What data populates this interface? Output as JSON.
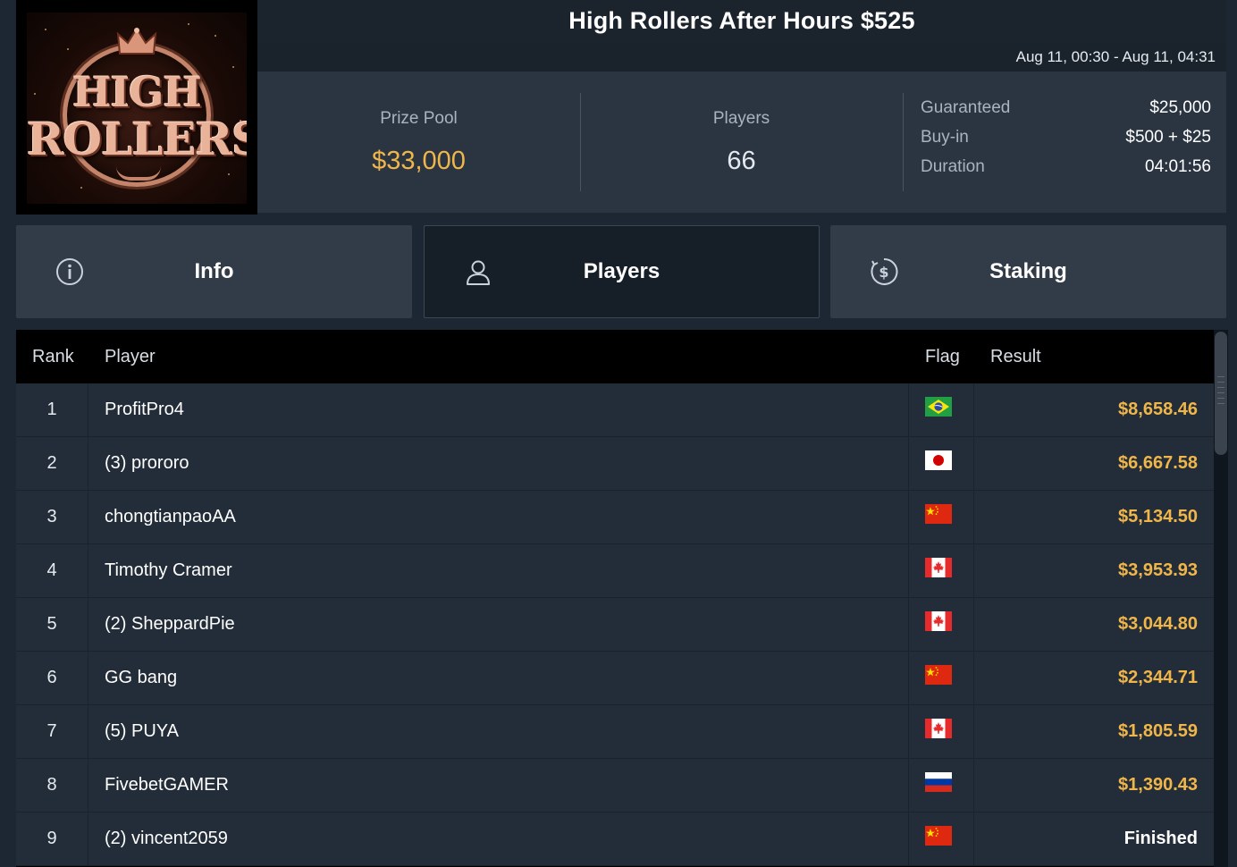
{
  "logo": {
    "line1": "HIGH",
    "line2": "ROLLERS"
  },
  "title": "High Rollers After Hours $525",
  "date_range": "Aug 11, 00:30 - Aug 11, 04:31",
  "stats": {
    "prize_pool_label": "Prize Pool",
    "prize_pool_value": "$33,000",
    "players_label": "Players",
    "players_value": "66"
  },
  "details": [
    {
      "key": "Guaranteed",
      "value": "$25,000"
    },
    {
      "key": "Buy-in",
      "value": "$500 + $25"
    },
    {
      "key": "Duration",
      "value": "04:01:56"
    }
  ],
  "tabs": [
    {
      "label": "Info",
      "icon": "info-icon",
      "active": false
    },
    {
      "label": "Players",
      "icon": "user-icon",
      "active": true
    },
    {
      "label": "Staking",
      "icon": "dollar-coin-icon",
      "active": false
    }
  ],
  "table": {
    "headers": {
      "rank": "Rank",
      "player": "Player",
      "flag": "Flag",
      "result": "Result"
    },
    "rows": [
      {
        "rank": "1",
        "player": "ProfitPro4",
        "flag": "brazil",
        "result": "$8,658.46"
      },
      {
        "rank": "2",
        "player": "(3) prororo",
        "flag": "japan",
        "result": "$6,667.58"
      },
      {
        "rank": "3",
        "player": "chongtianpaoAA",
        "flag": "china",
        "result": "$5,134.50"
      },
      {
        "rank": "4",
        "player": "Timothy Cramer",
        "flag": "canada",
        "result": "$3,953.93"
      },
      {
        "rank": "5",
        "player": "(2) SheppardPie",
        "flag": "canada",
        "result": "$3,044.80"
      },
      {
        "rank": "6",
        "player": "GG bang",
        "flag": "china",
        "result": "$2,344.71"
      },
      {
        "rank": "7",
        "player": "(5) PUYA",
        "flag": "canada",
        "result": "$1,805.59"
      },
      {
        "rank": "8",
        "player": "FivebetGAMER",
        "flag": "russia",
        "result": "$1,390.43"
      },
      {
        "rank": "9",
        "player": "(2) vincent2059",
        "flag": "china",
        "result": "Finished"
      }
    ]
  },
  "colors": {
    "accent_gold": "#f0b64a",
    "background": "#1d2733",
    "panel": "#2b3542",
    "row": "#232d39"
  }
}
